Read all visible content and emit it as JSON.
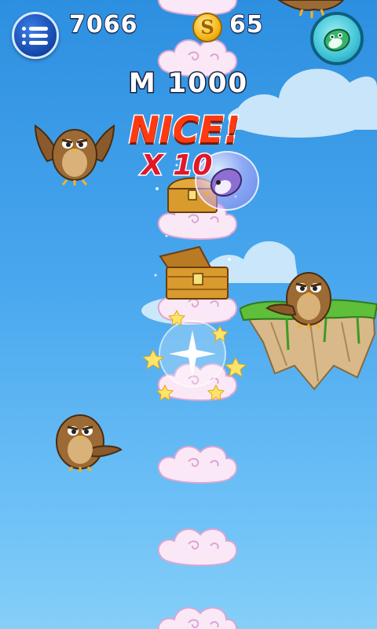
{
  "hud": {
    "score": "7066",
    "coins": "65",
    "coin_symbol": "S"
  },
  "overlay": {
    "meter": "M 1000",
    "praise": "NICE!",
    "combo": "X 10"
  },
  "colors": {
    "sky_top": "#2d8fe0",
    "sky_bottom": "#85cff8",
    "praise": "#ff3a12",
    "combo": "#e0182a",
    "coin": "#f6b619",
    "cloud": "#fbe8f6"
  },
  "icons": {
    "menu": "menu-list-icon",
    "coin": "coin-icon",
    "character": "penguin-character-icon",
    "enemy": "owl-icon",
    "chest": "treasure-chest-icon",
    "cloud": "cloud-platform",
    "powerup": "star-burst-icon"
  }
}
